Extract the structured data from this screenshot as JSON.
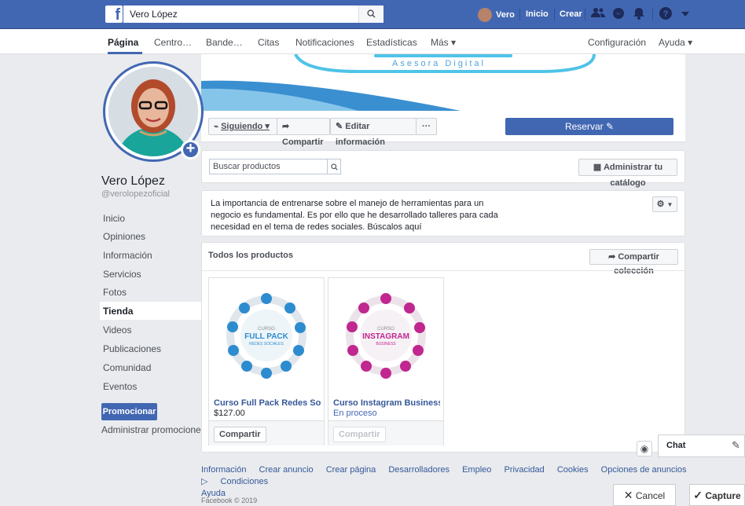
{
  "topbar": {
    "search_value": "Vero López",
    "user_name": "Vero",
    "home_label": "Inicio",
    "create_label": "Crear"
  },
  "page_nav": {
    "items": [
      "Página",
      "Centro…",
      "Bande…",
      "Citas",
      "Notificaciones",
      "Estadísticas",
      "Más ▾"
    ],
    "right": [
      "Configuración",
      "Ayuda ▾"
    ]
  },
  "cover": {
    "brand_text": "Asesora Digital"
  },
  "actions": {
    "following": "Siguiendo ▾",
    "share": "Compartir",
    "edit": "Editar información",
    "more": "···",
    "reserve": "Reservar"
  },
  "profile": {
    "name": "Vero López",
    "handle": "@verolopezoficial"
  },
  "sidebar": {
    "items": [
      "Inicio",
      "Opiniones",
      "Información",
      "Servicios",
      "Fotos",
      "Tienda",
      "Videos",
      "Publicaciones",
      "Comunidad",
      "Eventos"
    ],
    "active": "Tienda",
    "promote": "Promocionar",
    "manage_promos": "Administrar promociones"
  },
  "shop": {
    "search_placeholder": "Buscar productos",
    "manage_catalog": "Administrar tu catálogo",
    "description": "La importancia de entrenarse sobre el manejo de herramientas para un negocio es fundamental. Es por ello que he desarrollado talleres para cada necesidad en el tema de redes sociales. Búscalos aquí",
    "collection_title": "Todos los productos",
    "share_collection": "Compartir colección",
    "products": [
      {
        "title": "Curso Full Pack Redes Social…",
        "sub": "$127.00",
        "share": "Compartir",
        "thumb_line1": "CURSO",
        "thumb_line2": "FULL PACK",
        "thumb_line3": "REDES SOCIALES",
        "color": "#2d8ccf"
      },
      {
        "title": "Curso Instagram Business",
        "sub": "En proceso",
        "share": "Compartir",
        "thumb_line1": "CURSO",
        "thumb_line2": "INSTAGRAM",
        "thumb_line3": "BUSINESS",
        "color": "#c0278f"
      }
    ]
  },
  "footer": {
    "links": [
      "Información",
      "Crear anuncio",
      "Crear página",
      "Desarrolladores",
      "Empleo",
      "Privacidad",
      "Cookies",
      "Opciones de anuncios ▷",
      "Condiciones",
      "Ayuda"
    ],
    "copyright": "Facebook © 2019"
  },
  "chat": {
    "label": "Chat"
  },
  "overlay": {
    "cancel": "Cancel",
    "capture": "Capture"
  },
  "colors": {
    "brand": "#4267b2",
    "link": "#365899"
  }
}
